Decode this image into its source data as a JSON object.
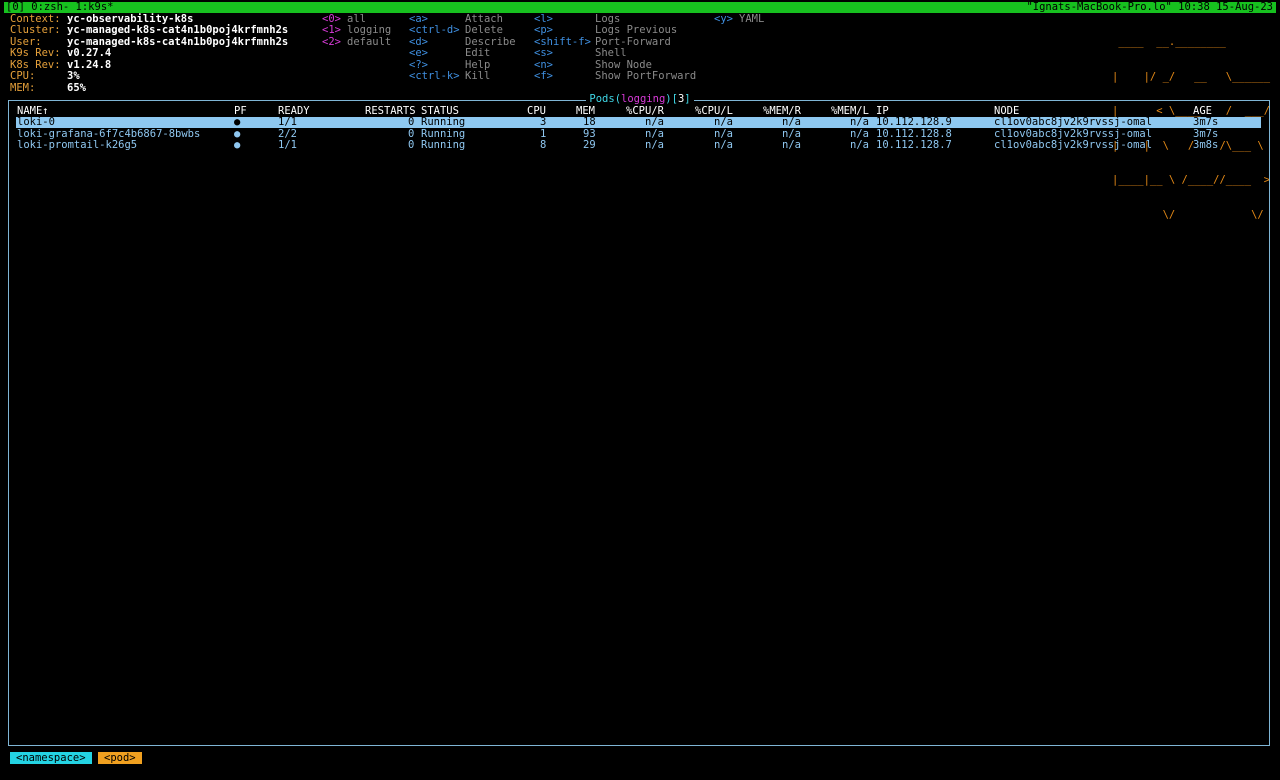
{
  "tmux": {
    "left": "[0] 0:zsh- 1:k9s*",
    "right": "\"Ignats-MacBook-Pro.lo\" 10:38 15-Aug-23"
  },
  "info": [
    {
      "label": "Context:",
      "value": "yc-observability-k8s"
    },
    {
      "label": "Cluster:",
      "value": "yc-managed-k8s-cat4n1b0poj4krfmnh2s"
    },
    {
      "label": "User:",
      "value": "yc-managed-k8s-cat4n1b0poj4krfmnh2s"
    },
    {
      "label": "K9s Rev:",
      "value": "v0.27.4"
    },
    {
      "label": "K8s Rev:",
      "value": "v1.24.8"
    },
    {
      "label": "CPU:",
      "value": "3%"
    },
    {
      "label": "MEM:",
      "value": "65%"
    }
  ],
  "namespaces": [
    {
      "key": "<0>",
      "name": "all"
    },
    {
      "key": "<1>",
      "name": "logging"
    },
    {
      "key": "<2>",
      "name": "default"
    }
  ],
  "hotkeys_col1": [
    {
      "key": "<a>",
      "desc": "Attach"
    },
    {
      "key": "<ctrl-d>",
      "desc": "Delete"
    },
    {
      "key": "<d>",
      "desc": "Describe"
    },
    {
      "key": "<e>",
      "desc": "Edit"
    },
    {
      "key": "<?>",
      "desc": "Help"
    },
    {
      "key": "<ctrl-k>",
      "desc": "Kill"
    }
  ],
  "hotkeys_col2": [
    {
      "key": "<l>",
      "desc": "Logs"
    },
    {
      "key": "<p>",
      "desc": "Logs Previous"
    },
    {
      "key": "<shift-f>",
      "desc": "Port-Forward"
    },
    {
      "key": "<s>",
      "desc": "Shell"
    },
    {
      "key": "<n>",
      "desc": "Show Node"
    },
    {
      "key": "<f>",
      "desc": "Show PortForward"
    }
  ],
  "hotkeys_col3": [
    {
      "key": "<y>",
      "desc": "YAML"
    }
  ],
  "logo_lines": [
    " ____  __.________       ",
    "|    |/ _/   __   \\______",
    "|      < \\____    /  ___/",
    "|    |  \\   /    /\\___ \\ ",
    "|____|__ \\ /____//____  >",
    "        \\/            \\/ "
  ],
  "pods_view": {
    "resource": "Pods",
    "namespace": "logging",
    "count": "3"
  },
  "table": {
    "headers": {
      "name": "NAME↑",
      "pf": "PF",
      "ready": "READY",
      "restarts": "RESTARTS",
      "status": "STATUS",
      "cpu": "CPU",
      "mem": "MEM",
      "cpur": "%CPU/R",
      "cpul": "%CPU/L",
      "memr": "%MEM/R",
      "meml": "%MEM/L",
      "ip": "IP",
      "node": "NODE",
      "age": "AGE"
    },
    "rows": [
      {
        "name": "loki-0",
        "pf": "●",
        "ready": "1/1",
        "restarts": "0",
        "status": "Running",
        "cpu": "3",
        "mem": "18",
        "cpur": "n/a",
        "cpul": "n/a",
        "memr": "n/a",
        "meml": "n/a",
        "ip": "10.112.128.9",
        "node": "cl1ov0abc8jv2k9rvssj-omal",
        "age": "3m7s"
      },
      {
        "name": "loki-grafana-6f7c4b6867-8bwbs",
        "pf": "●",
        "ready": "2/2",
        "restarts": "0",
        "status": "Running",
        "cpu": "1",
        "mem": "93",
        "cpur": "n/a",
        "cpul": "n/a",
        "memr": "n/a",
        "meml": "n/a",
        "ip": "10.112.128.8",
        "node": "cl1ov0abc8jv2k9rvssj-omal",
        "age": "3m7s"
      },
      {
        "name": "loki-promtail-k26g5",
        "pf": "●",
        "ready": "1/1",
        "restarts": "0",
        "status": "Running",
        "cpu": "8",
        "mem": "29",
        "cpur": "n/a",
        "cpul": "n/a",
        "memr": "n/a",
        "meml": "n/a",
        "ip": "10.112.128.7",
        "node": "cl1ov0abc8jv2k9rvssj-omal",
        "age": "3m8s"
      }
    ]
  },
  "breadcrumbs": {
    "namespace": "<namespace>",
    "pod": "<pod>"
  }
}
